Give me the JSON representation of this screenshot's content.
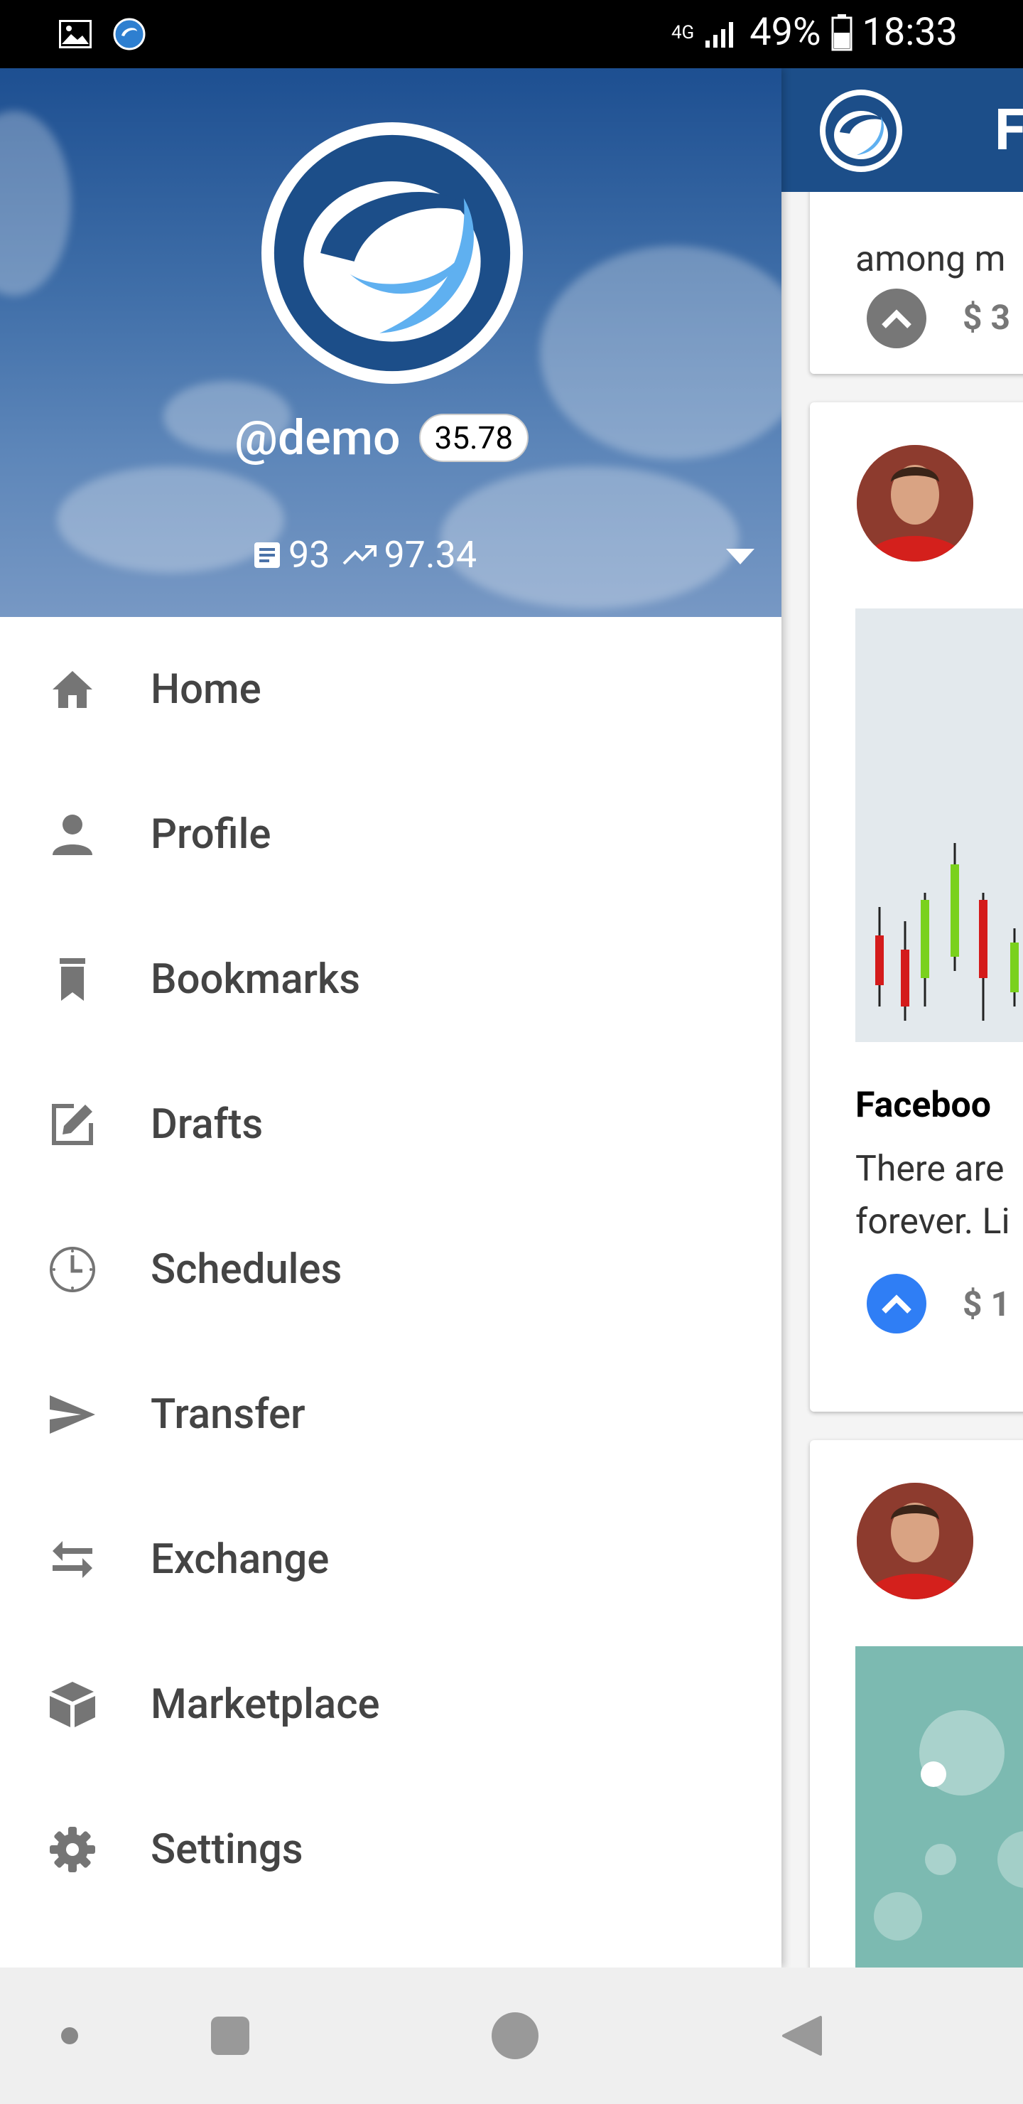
{
  "status_bar": {
    "network": "4G",
    "battery": "49%",
    "time": "18:33"
  },
  "drawer": {
    "username": "@demo",
    "reputation": "35.78",
    "posts_count": "93",
    "voting_power": "97.34",
    "menu": [
      {
        "label": "Home",
        "icon": "home-icon"
      },
      {
        "label": "Profile",
        "icon": "person-icon"
      },
      {
        "label": "Bookmarks",
        "icon": "bookmark-icon"
      },
      {
        "label": "Drafts",
        "icon": "edit-icon"
      },
      {
        "label": "Schedules",
        "icon": "clock-icon"
      },
      {
        "label": "Transfer",
        "icon": "send-icon"
      },
      {
        "label": "Exchange",
        "icon": "swap-icon"
      },
      {
        "label": "Marketplace",
        "icon": "cube-icon"
      },
      {
        "label": "Settings",
        "icon": "gear-icon"
      }
    ]
  },
  "feed": {
    "header_title": "F",
    "card1_text": "among m",
    "card1_payout": "$ 3",
    "card2_title": "Faceboo",
    "card2_body_line1": "There are",
    "card2_body_line2": "forever. Li",
    "card2_payout": "$ 1"
  },
  "colors": {
    "header_blue": "#1c4e89",
    "vote_blue": "#2f7ef5",
    "icon_grey": "#757575"
  }
}
